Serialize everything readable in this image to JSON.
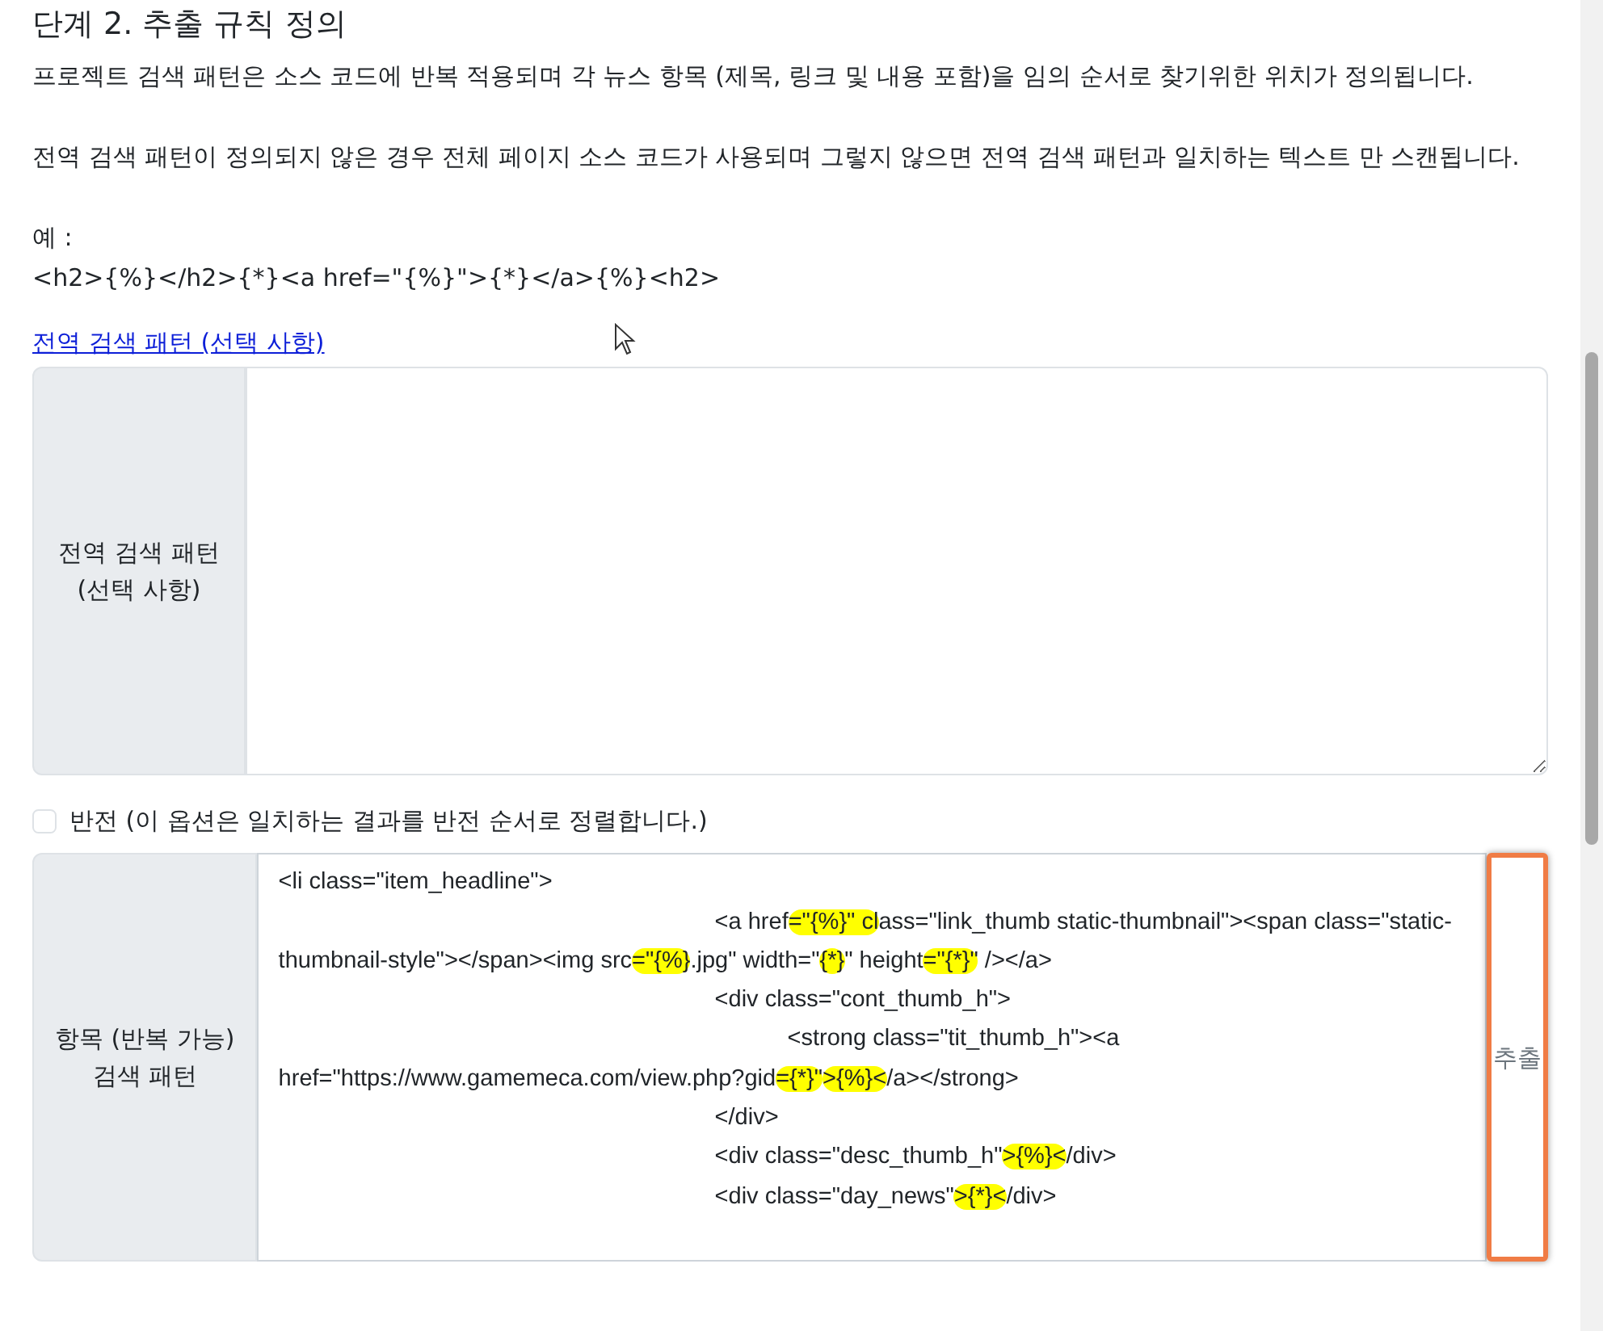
{
  "heading": "단계 2. 추출 규칙 정의",
  "paragraphs": [
    "프로젝트 검색 패턴은 소스 코드에 반복 적용되며 각 뉴스 항목 (제목, 링크 및 내용 포함)을 임의 순서로 찾기위한 위치가 정의됩니다.",
    "전역 검색 패턴이 정의되지 않은 경우 전체 페이지 소스 코드가 사용되며 그렇지 않으면 전역 검색 패턴과 일치하는 텍스트 만 스캔됩니다."
  ],
  "example": {
    "label": "예 :",
    "code": "<h2>{%}</h2>{*}<a href=\"{%}\">{*}</a>{%}<h2>"
  },
  "link": "전역 검색 패턴 (선택 사항)",
  "global_pattern": {
    "label": "전역 검색 패턴 (선택 사항)"
  },
  "reverse": {
    "label": "반전 (이 옵션은 일치하는 결과를 반전 순서로 정렬합니다.)",
    "checked": false
  },
  "item_pattern": {
    "label": "항목 (반복 가능) 검색 패턴",
    "button": "추출",
    "button_outlined": true,
    "lines": [
      [
        {
          "text": "<li class=\"item_headline\">",
          "highlighted": false
        }
      ],
      [
        {
          "text": "\t\t\t\t\t\t<a href",
          "highlighted": false
        },
        {
          "text": "=\"{%}\" cl",
          "highlighted": true
        },
        {
          "text": "ass=\"link_thumb static-thumbnail\"><span class=\"static-thumbnail-style\"></span><img src",
          "highlighted": false
        },
        {
          "text": "=\"{%}",
          "highlighted": true
        },
        {
          "text": ".jpg\" width=\"",
          "highlighted": false
        },
        {
          "text": "{*}",
          "highlighted": true
        },
        {
          "text": "\" height",
          "highlighted": false
        },
        {
          "text": "=\"{*}\"",
          "highlighted": true
        },
        {
          "text": " /></a>",
          "highlighted": false
        }
      ],
      [
        {
          "text": "\t\t\t\t\t\t<div class=\"cont_thumb_h\">",
          "highlighted": false
        }
      ],
      [
        {
          "text": "\t\t\t\t\t\t\t<strong class=\"tit_thumb_h\"><a href=\"https://www.gamemeca.com/view.php?gid",
          "highlighted": false
        },
        {
          "text": "={*}\"",
          "highlighted": true
        },
        {
          "text": ">{%}<",
          "highlighted": true
        },
        {
          "text": "/a></strong>",
          "highlighted": false
        }
      ],
      [
        {
          "text": "\t\t\t\t\t\t</div>",
          "highlighted": false
        }
      ],
      [
        {
          "text": "\t\t\t\t\t\t<div class=\"desc_thumb_h\"",
          "highlighted": false
        },
        {
          "text": ">{%}<",
          "highlighted": true
        },
        {
          "text": "/div>",
          "highlighted": false
        }
      ],
      [
        {
          "text": "\t\t\t\t\t\t<div class=\"day_news\"",
          "highlighted": false
        },
        {
          "text": ">{*}<",
          "highlighted": true
        },
        {
          "text": "/div>",
          "highlighted": false
        }
      ]
    ]
  }
}
